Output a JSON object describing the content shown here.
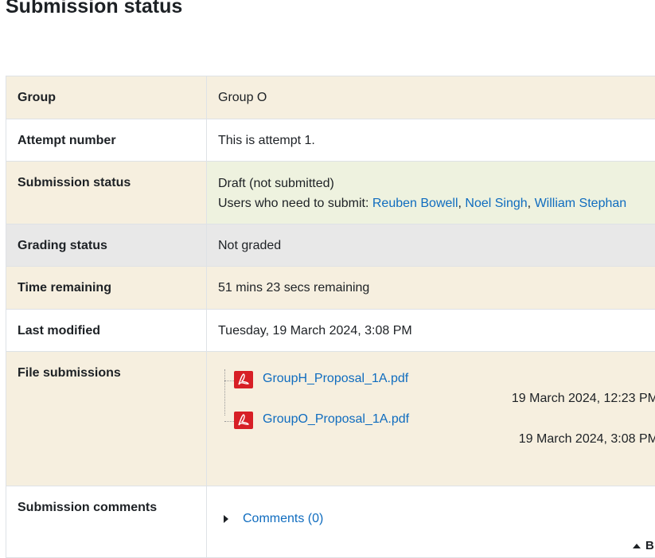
{
  "page": {
    "title": "Submission status"
  },
  "rows": {
    "group": {
      "label": "Group",
      "value": "Group O"
    },
    "attempt": {
      "label": "Attempt number",
      "value": "This is attempt 1."
    },
    "status": {
      "label": "Submission status",
      "value": "Draft (not submitted)",
      "users_prefix": "Users who need to submit: ",
      "users": [
        "Reuben Bowell",
        "Noel Singh",
        "William Stephan"
      ],
      "separator": ", "
    },
    "grading": {
      "label": "Grading status",
      "value": "Not graded"
    },
    "time": {
      "label": "Time remaining",
      "value": "51 mins 23 secs remaining"
    },
    "modified": {
      "label": "Last modified",
      "value": "Tuesday, 19 March 2024, 3:08 PM"
    },
    "files": {
      "label": "File submissions",
      "items": [
        {
          "name": "GroupH_Proposal_1A.pdf",
          "date": "19 March 2024, 12:23 PM",
          "icon": "pdf-icon"
        },
        {
          "name": "GroupO_Proposal_1A.pdf",
          "date": "19 March 2024, 3:08 PM",
          "icon": "pdf-icon"
        }
      ]
    },
    "comments": {
      "label": "Submission comments",
      "toggle": "Comments (0)"
    }
  },
  "footer": {
    "back_to_top": "B"
  },
  "colors": {
    "link": "#0f6cbf",
    "row_highlight": "#f6efdf",
    "status_bg": "#eef2df",
    "grading_bg": "#e8e8e8",
    "pdf_red": "#d71f26"
  }
}
